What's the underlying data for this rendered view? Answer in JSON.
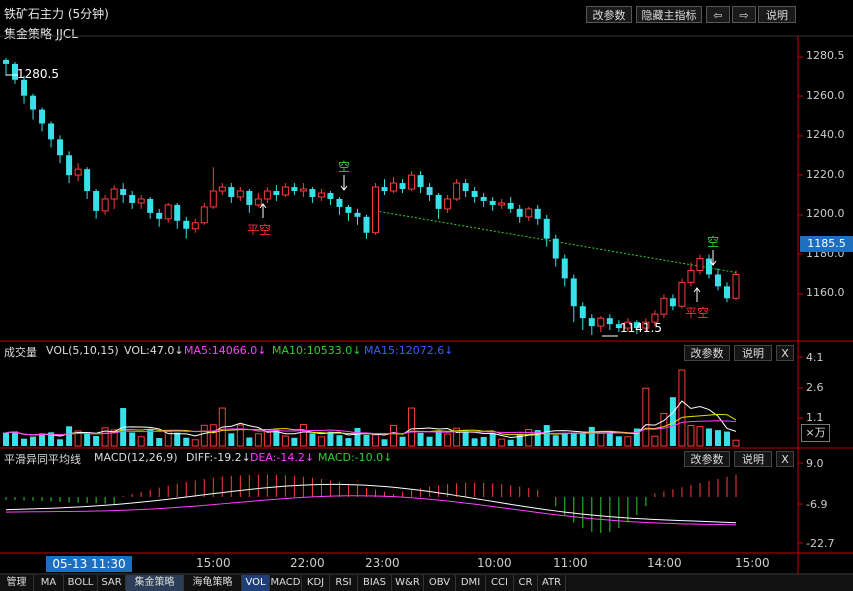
{
  "window": {
    "title": "铁矿石主力 (5分钟)",
    "strategy": "集金策略 JJCL"
  },
  "toolbar": {
    "params": "改参数",
    "hide": "隐藏主指标",
    "left": "⇦",
    "right": "⇨",
    "help": "说明"
  },
  "price_axis": {
    "labels": [
      "1280.5",
      "1260.0",
      "1240.0",
      "1220.0",
      "1200.0",
      "1180.0",
      "1160.0"
    ],
    "current": "1185.5"
  },
  "annotations": {
    "high": "1280.5",
    "low": "1141.5",
    "short1": "空",
    "cover1": "平空",
    "short2": "空",
    "cover2": "平空"
  },
  "volume_panel": {
    "name": "成交量",
    "params": "VOL(5,10,15)",
    "vol": "VOL:47.0↓",
    "ma5": "MA5:14066.0↓",
    "ma10": "MA10:10533.0↓",
    "ma15": "MA15:12072.6↓",
    "btn_params": "改参数",
    "btn_help": "说明",
    "btn_close": "X",
    "axis": [
      "4.1",
      "2.6",
      "1.1"
    ],
    "unit": "×万"
  },
  "macd_panel": {
    "name": "平滑异同平均线",
    "params": "MACD(12,26,9)",
    "diff": "DIFF:-19.2↓",
    "dea": "DEA:-14.2↓",
    "macd": "MACD:-10.0↓",
    "btn_params": "改参数",
    "btn_help": "说明",
    "btn_close": "X",
    "axis": [
      "9.0",
      "-6.9",
      "-22.7"
    ]
  },
  "time_axis": {
    "cursor": "05-13 11:30",
    "labels": [
      "15:00",
      "22:00",
      "23:00",
      "10:00",
      "11:00",
      "14:00",
      "15:00"
    ]
  },
  "tabs": [
    "管理",
    "MA",
    "BOLL",
    "SAR",
    "集金策略",
    "海龟策略",
    "VOL",
    "MACD",
    "KDJ",
    "RSI",
    "BIAS",
    "W&R",
    "OBV",
    "DMI",
    "CCI",
    "CR",
    "ATR"
  ],
  "colors": {
    "up": "#ff3b3b",
    "down": "#38e0e8",
    "ma5": "#ffffff",
    "ma10": "#e0e000",
    "ma15": "#ff40ff",
    "dea": "#ff40ff",
    "grid": "#c00000",
    "accent": "#1f6fbf"
  },
  "chart_data": {
    "type": "candlestick",
    "ylim": [
      1140,
      1285
    ],
    "candles": [
      [
        1280,
        1278,
        1281,
        1272
      ],
      [
        1278,
        1270,
        1279,
        1268
      ],
      [
        1270,
        1262,
        1272,
        1258
      ],
      [
        1262,
        1255,
        1263,
        1250
      ],
      [
        1255,
        1248,
        1256,
        1244
      ],
      [
        1248,
        1240,
        1249,
        1236
      ],
      [
        1240,
        1232,
        1242,
        1228
      ],
      [
        1232,
        1222,
        1234,
        1218
      ],
      [
        1222,
        1225,
        1228,
        1219
      ],
      [
        1225,
        1214,
        1226,
        1210
      ],
      [
        1214,
        1204,
        1215,
        1200
      ],
      [
        1204,
        1210,
        1212,
        1202
      ],
      [
        1210,
        1215,
        1217,
        1205
      ],
      [
        1215,
        1212,
        1218,
        1208
      ],
      [
        1212,
        1208,
        1214,
        1205
      ],
      [
        1208,
        1210,
        1212,
        1205
      ],
      [
        1210,
        1203,
        1211,
        1200
      ],
      [
        1203,
        1200,
        1205,
        1196
      ],
      [
        1200,
        1207,
        1208,
        1198
      ],
      [
        1207,
        1199,
        1208,
        1195
      ],
      [
        1199,
        1195,
        1201,
        1190
      ],
      [
        1195,
        1198,
        1200,
        1193
      ],
      [
        1198,
        1206,
        1208,
        1197
      ],
      [
        1206,
        1214,
        1226,
        1205
      ],
      [
        1214,
        1216,
        1218,
        1212
      ],
      [
        1216,
        1211,
        1218,
        1208
      ],
      [
        1211,
        1214,
        1216,
        1209
      ],
      [
        1214,
        1207,
        1215,
        1203
      ],
      [
        1207,
        1210,
        1213,
        1206
      ],
      [
        1210,
        1214,
        1216,
        1208
      ],
      [
        1214,
        1212,
        1217,
        1209
      ],
      [
        1212,
        1216,
        1218,
        1211
      ],
      [
        1216,
        1214,
        1218,
        1212
      ],
      [
        1214,
        1215,
        1218,
        1211
      ],
      [
        1215,
        1211,
        1216,
        1208
      ],
      [
        1211,
        1213,
        1215,
        1209
      ],
      [
        1213,
        1210,
        1214,
        1207
      ],
      [
        1210,
        1206,
        1211,
        1202
      ],
      [
        1206,
        1203,
        1207,
        1199
      ],
      [
        1203,
        1201,
        1205,
        1197
      ],
      [
        1201,
        1193,
        1202,
        1190
      ],
      [
        1193,
        1216,
        1218,
        1192
      ],
      [
        1216,
        1214,
        1220,
        1212
      ],
      [
        1214,
        1218,
        1221,
        1213
      ],
      [
        1218,
        1215,
        1220,
        1213
      ],
      [
        1215,
        1222,
        1224,
        1214
      ],
      [
        1222,
        1216,
        1224,
        1213
      ],
      [
        1216,
        1212,
        1218,
        1209
      ],
      [
        1212,
        1205,
        1213,
        1200
      ],
      [
        1205,
        1210,
        1212,
        1203
      ],
      [
        1210,
        1218,
        1220,
        1209
      ],
      [
        1218,
        1214,
        1220,
        1211
      ],
      [
        1214,
        1211,
        1216,
        1208
      ],
      [
        1211,
        1209,
        1213,
        1206
      ],
      [
        1209,
        1207,
        1211,
        1204
      ],
      [
        1207,
        1208,
        1210,
        1205
      ],
      [
        1208,
        1205,
        1211,
        1203
      ],
      [
        1205,
        1201,
        1207,
        1198
      ],
      [
        1201,
        1205,
        1206,
        1199
      ],
      [
        1205,
        1200,
        1207,
        1197
      ],
      [
        1200,
        1190,
        1202,
        1186
      ],
      [
        1190,
        1180,
        1192,
        1176
      ],
      [
        1180,
        1170,
        1182,
        1166
      ],
      [
        1170,
        1156,
        1172,
        1148
      ],
      [
        1156,
        1150,
        1158,
        1144
      ],
      [
        1150,
        1146,
        1152,
        1141.5
      ],
      [
        1146,
        1150,
        1151,
        1143
      ],
      [
        1150,
        1147,
        1152,
        1144
      ],
      [
        1147,
        1145,
        1149,
        1143
      ],
      [
        1145,
        1148,
        1150,
        1143
      ],
      [
        1148,
        1145,
        1149,
        1142
      ],
      [
        1145,
        1148,
        1150,
        1143
      ],
      [
        1148,
        1152,
        1154,
        1146
      ],
      [
        1152,
        1160,
        1162,
        1150
      ],
      [
        1160,
        1156,
        1162,
        1154
      ],
      [
        1156,
        1168,
        1170,
        1155
      ],
      [
        1168,
        1174,
        1178,
        1166
      ],
      [
        1174,
        1180,
        1182,
        1172
      ],
      [
        1180,
        1172,
        1182,
        1170
      ],
      [
        1172,
        1166,
        1175,
        1164
      ],
      [
        1166,
        1160,
        1168,
        1158
      ],
      [
        1160,
        1172,
        1174,
        1159
      ]
    ]
  }
}
